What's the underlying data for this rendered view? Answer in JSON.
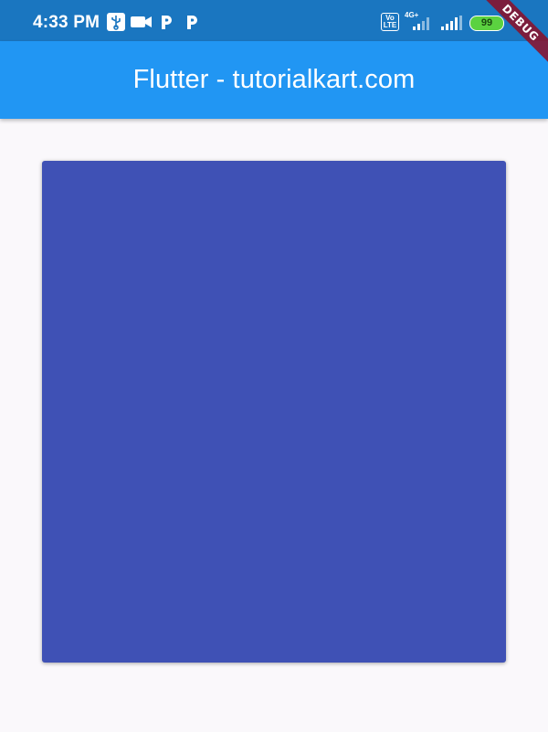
{
  "status_bar": {
    "time": "4:33 PM",
    "left_icons": [
      "usb-icon",
      "video-camera-icon",
      "parking-app-icon",
      "parking-app-icon"
    ],
    "volte_label_top": "Vo",
    "volte_label_bottom": "LTE",
    "network_type": "4G+",
    "battery_level": "99",
    "colors": {
      "background": "#1a76c0",
      "battery": "#5bd240"
    }
  },
  "app_bar": {
    "title": "Flutter - tutorialkart.com",
    "color": "#2196f3"
  },
  "body": {
    "background": "#faf8fb",
    "card_color": "#3f51b5"
  },
  "debug_banner": {
    "label": "DEBUG",
    "color": "#8a112a"
  }
}
